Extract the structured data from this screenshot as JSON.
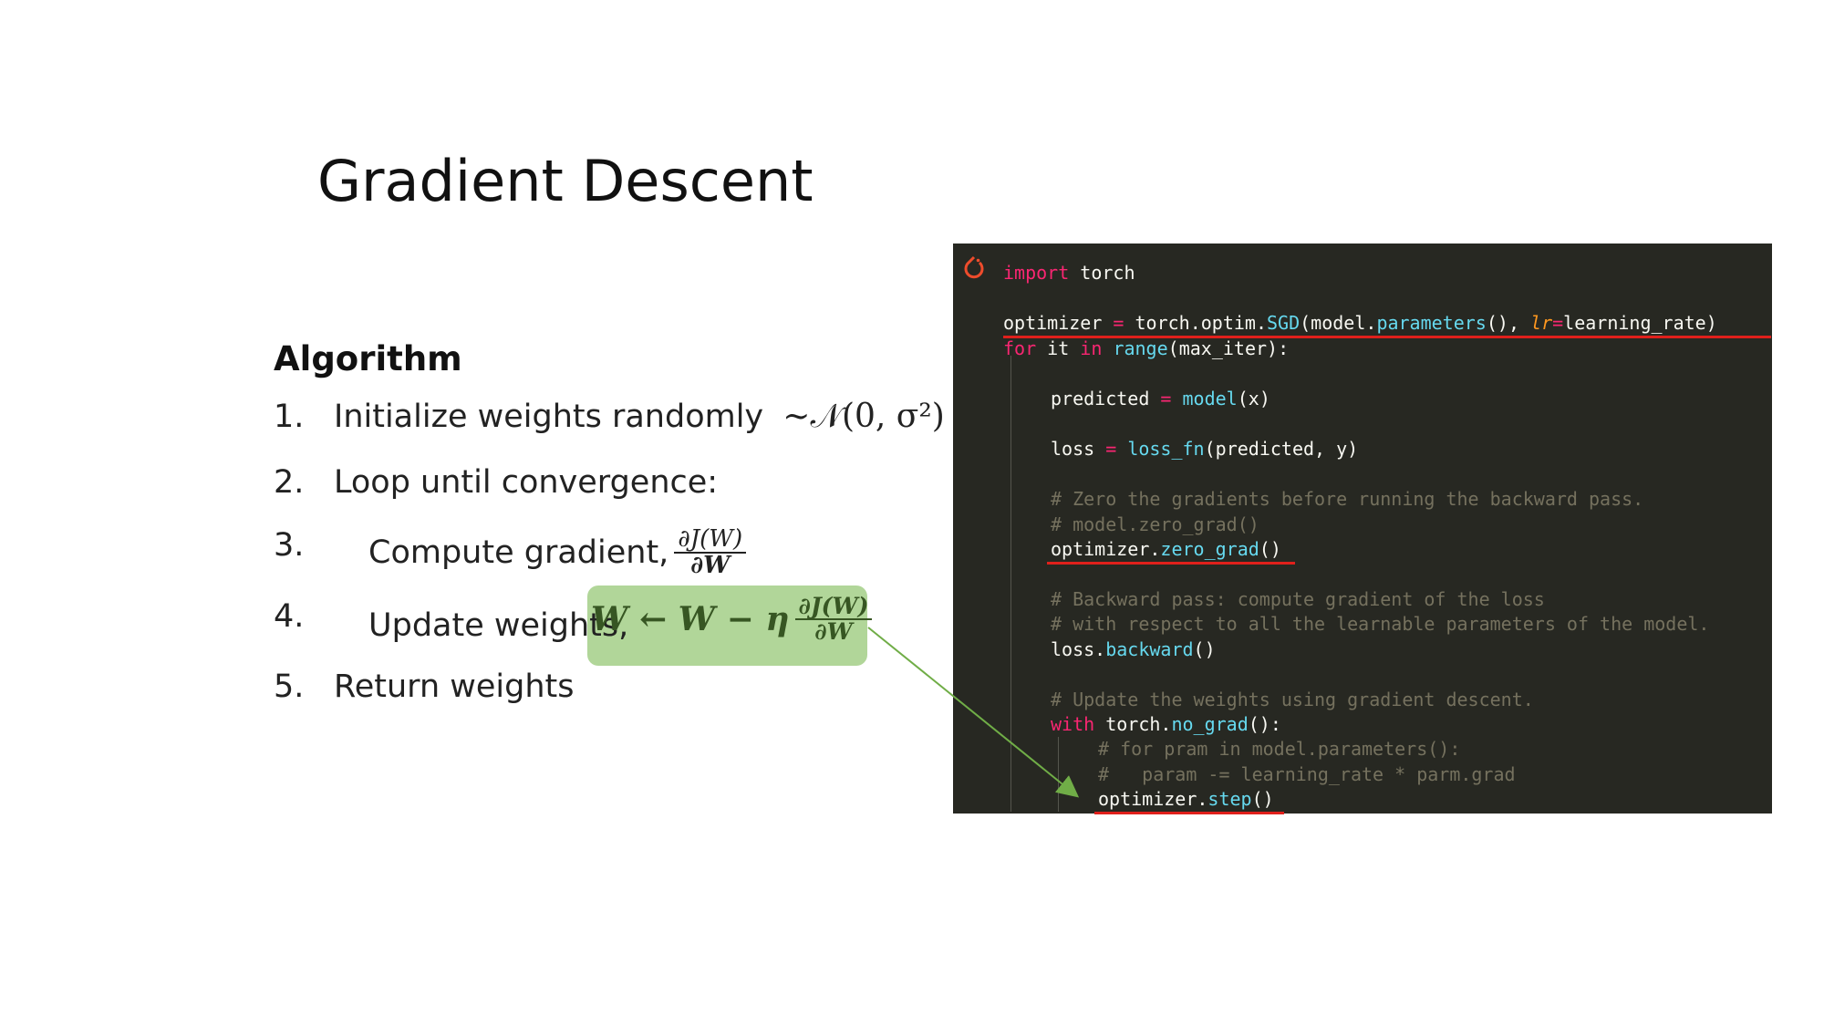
{
  "slide": {
    "title": "Gradient Descent"
  },
  "algorithm": {
    "heading": "Algorithm",
    "steps": [
      {
        "num": "1.",
        "text": "Initialize weights randomly",
        "math": "~𝒩(0, σ²)"
      },
      {
        "num": "2.",
        "text": "Loop until convergence:"
      },
      {
        "num": "3.",
        "text": "Compute gradient,",
        "frac_top": "∂J(W)",
        "frac_bottom": "∂W"
      },
      {
        "num": "4.",
        "text": "Update weights,",
        "formula_lhs": "W ← W − η",
        "frac_top": "∂J(W)",
        "frac_bottom": "∂W"
      },
      {
        "num": "5.",
        "text": "Return weights"
      }
    ]
  },
  "code": {
    "logo_icon": "pytorch-logo-icon",
    "l1_kw": "import",
    "l1_rest": " torch",
    "l2_a": "optimizer ",
    "l2_eq": "=",
    "l2_b": " torch.optim.",
    "l2_sgd": "SGD",
    "l2_c": "(model.",
    "l2_params": "parameters",
    "l2_d": "(), ",
    "l2_lr": "lr",
    "l2_eq2": "=",
    "l2_e": "learning_rate)",
    "l3_for": "for",
    "l3_a": " it ",
    "l3_in": "in",
    "l3_b": " ",
    "l3_range": "range",
    "l3_c": "(max_iter):",
    "l4_a": "predicted ",
    "l4_eq": "=",
    "l4_b": " ",
    "l4_model": "model",
    "l4_c": "(x)",
    "l5_a": "loss ",
    "l5_eq": "=",
    "l5_b": " ",
    "l5_lossfn": "loss_fn",
    "l5_c": "(predicted, y)",
    "l6": "# Zero the gradients before running the backward pass.",
    "l7": "# model.zero_grad()",
    "l8_a": "optimizer.",
    "l8_fn": "zero_grad",
    "l8_b": "()",
    "l9": "# Backward pass: compute gradient of the loss",
    "l10": "# with respect to all the learnable parameters of the model.",
    "l11_a": "loss.",
    "l11_fn": "backward",
    "l11_b": "()",
    "l12": "# Update the weights using gradient descent.",
    "l13_with": "with",
    "l13_a": " torch.",
    "l13_fn": "no_grad",
    "l13_b": "():",
    "l14": "# for pram in model.parameters():",
    "l15": "#   param -= learning_rate * parm.grad",
    "l16_a": "optimizer.",
    "l16_fn": "step",
    "l16_b": "()"
  },
  "colors": {
    "highlight": "#a9d18e",
    "code_bg": "#272822",
    "underline": "#e0201b",
    "arrow": "#70ad47"
  }
}
